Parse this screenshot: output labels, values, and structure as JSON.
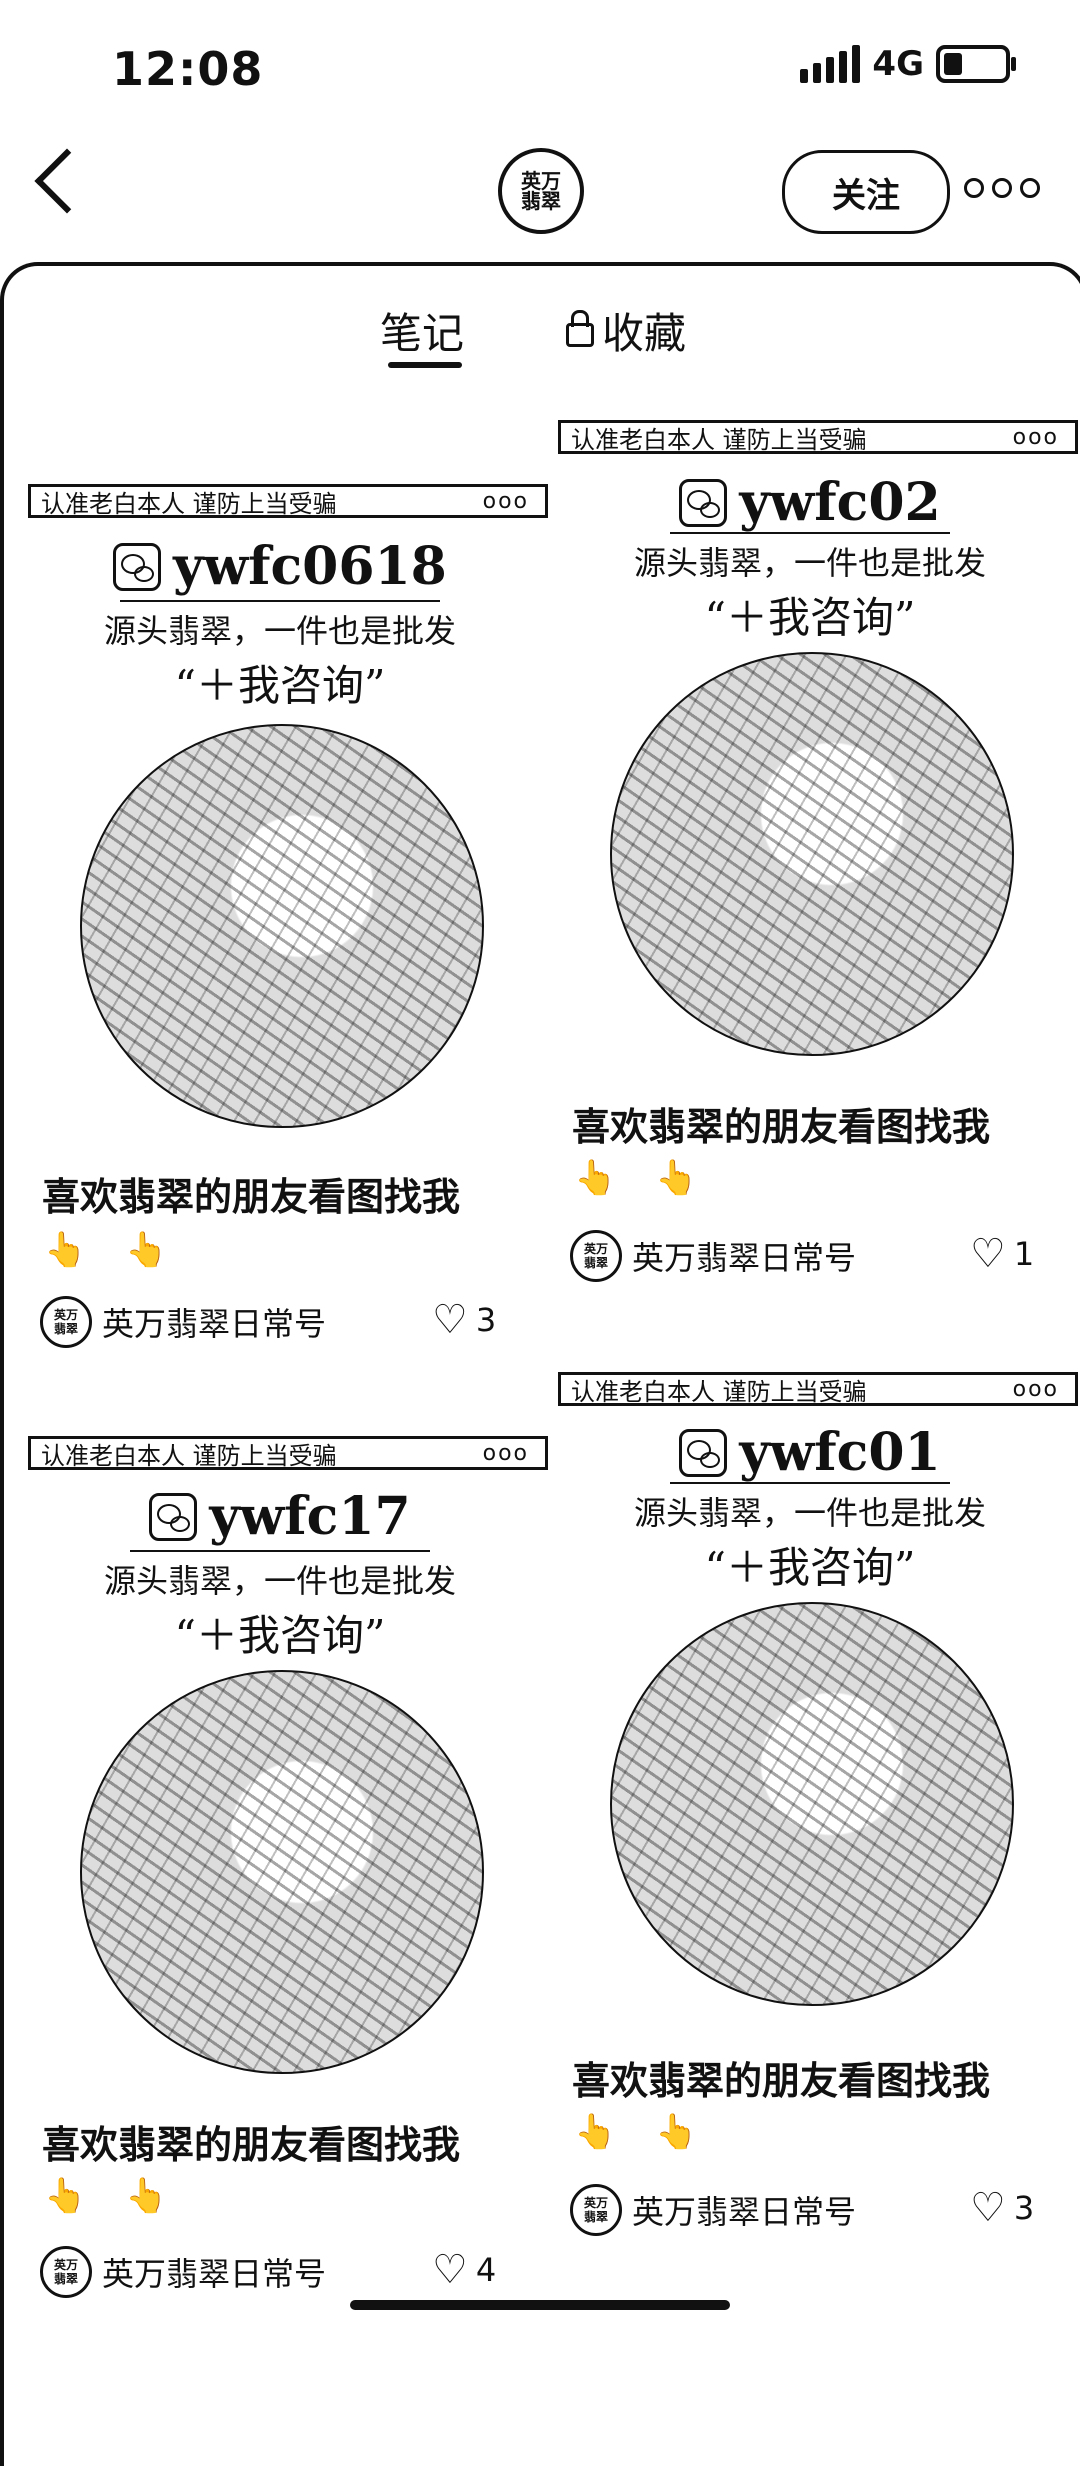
{
  "status": {
    "time": "12:08",
    "network": "4G"
  },
  "profile": {
    "avatar_text": "英万\n翡翠",
    "follow_label": "关注"
  },
  "tabs": {
    "notes": "笔记",
    "favorites": "收藏"
  },
  "common": {
    "banner": "认准老白本人  谨防上当受骗",
    "tag1": "源头翡翠，一件也是批发",
    "tag2": "“＋我咨询”",
    "title": "喜欢翡翠的朋友看图找我",
    "hands": "👆 👆",
    "author": "英万翡翠日常号",
    "dots": "ooo"
  },
  "cards": [
    {
      "id": "ywfc0618",
      "likes": "3"
    },
    {
      "id": "ywfc02",
      "likes": "1"
    },
    {
      "id": "ywfc17",
      "likes": "4"
    },
    {
      "id": "ywfc01",
      "likes": "3"
    }
  ]
}
